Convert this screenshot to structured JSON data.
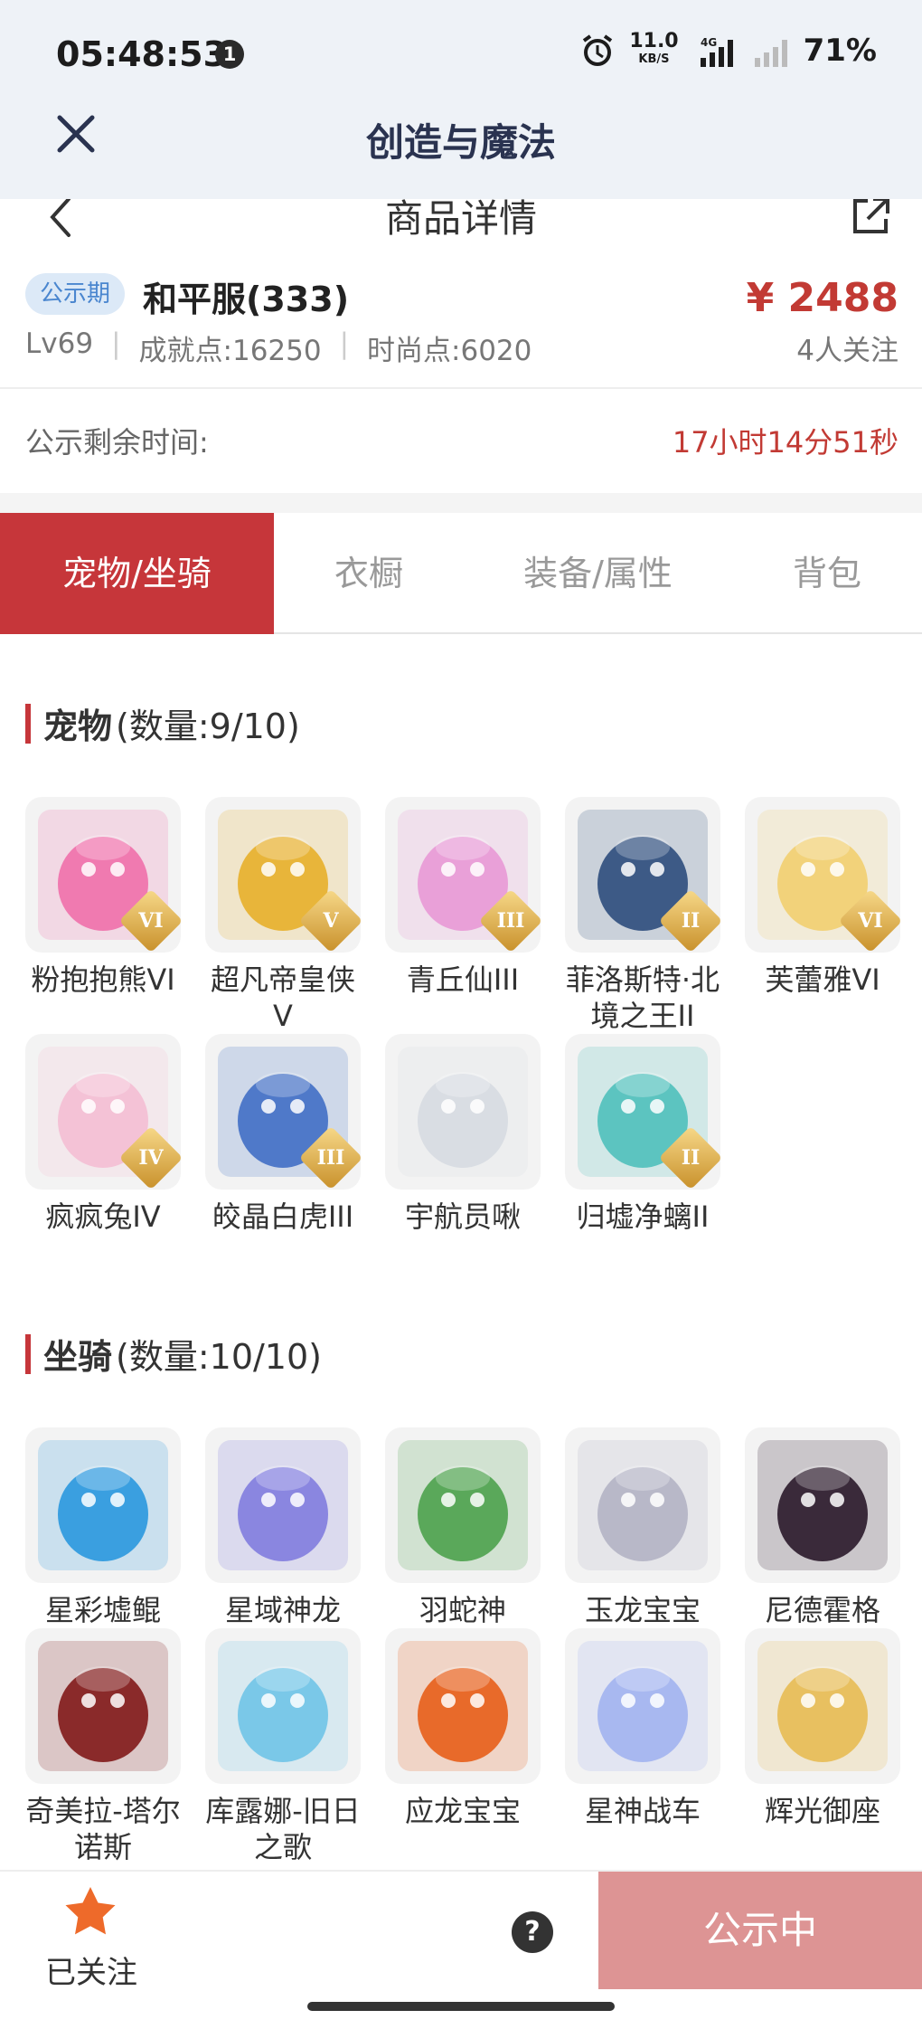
{
  "status_bar": {
    "time": "05:48:53",
    "notif_count": "1",
    "speed_value": "11.0",
    "speed_unit": "KB/S",
    "battery": "71%"
  },
  "app": {
    "title": "创造与魔法"
  },
  "header": {
    "title": "商品详情"
  },
  "summary": {
    "badge": "公示期",
    "server": "和平服(333)",
    "price": "¥ 2488",
    "level": "Lv69",
    "achievement": "成就点:16250",
    "fashion": "时尚点:6020",
    "followers": "4人关注"
  },
  "notice": {
    "label": "公示剩余时间:",
    "remaining": "17小时14分51秒"
  },
  "tabs": [
    {
      "label": "宠物/坐骑",
      "active": true
    },
    {
      "label": "衣橱",
      "active": false
    },
    {
      "label": "装备/属性",
      "active": false
    },
    {
      "label": "背包",
      "active": false
    }
  ],
  "pets": {
    "title": "宠物",
    "count": "(数量:9/10)",
    "items": [
      {
        "name": "粉抱抱熊VI",
        "rank": "VI",
        "color": "#f07ab0"
      },
      {
        "name": "超凡帝皇侠V",
        "rank": "V",
        "color": "#e8b53a"
      },
      {
        "name": "青丘仙III",
        "rank": "III",
        "color": "#e9a0d8"
      },
      {
        "name": "菲洛斯特·北境之王II",
        "rank": "II",
        "color": "#3d5a86"
      },
      {
        "name": "芙蕾雅VI",
        "rank": "VI",
        "color": "#f2d27a"
      },
      {
        "name": "疯疯兔IV",
        "rank": "IV",
        "color": "#f4c2d6"
      },
      {
        "name": "皎晶白虎III",
        "rank": "III",
        "color": "#4f79c9"
      },
      {
        "name": "宇航员啾",
        "rank": "",
        "color": "#d9dde3"
      },
      {
        "name": "归墟净螭II",
        "rank": "II",
        "color": "#5cc4c0"
      }
    ]
  },
  "mounts": {
    "title": "坐骑",
    "count": "(数量:10/10)",
    "items": [
      {
        "name": "星彩墟鲲",
        "color": "#3a9fe0"
      },
      {
        "name": "星域神龙",
        "color": "#8a86e0"
      },
      {
        "name": "羽蛇神",
        "color": "#5aa85a"
      },
      {
        "name": "玉龙宝宝",
        "color": "#b8b8c8"
      },
      {
        "name": "尼德霍格",
        "color": "#3a2a3a"
      },
      {
        "name": "奇美拉-塔尔诺斯",
        "color": "#8a2a2a"
      },
      {
        "name": "库露娜-旧日之歌",
        "color": "#7ac8e8"
      },
      {
        "name": "应龙宝宝",
        "color": "#e86a2a"
      },
      {
        "name": "星神战车",
        "color": "#a8b8f0"
      },
      {
        "name": "辉光御座",
        "color": "#e8c060"
      }
    ]
  },
  "bottom": {
    "follow_label": "已关注",
    "help": "?",
    "button": "公示中"
  },
  "colors": {
    "accent": "#c6363a",
    "price": "#c23a34",
    "badge_bg": "#dce9f7",
    "disabled_button": "#dd9494"
  }
}
